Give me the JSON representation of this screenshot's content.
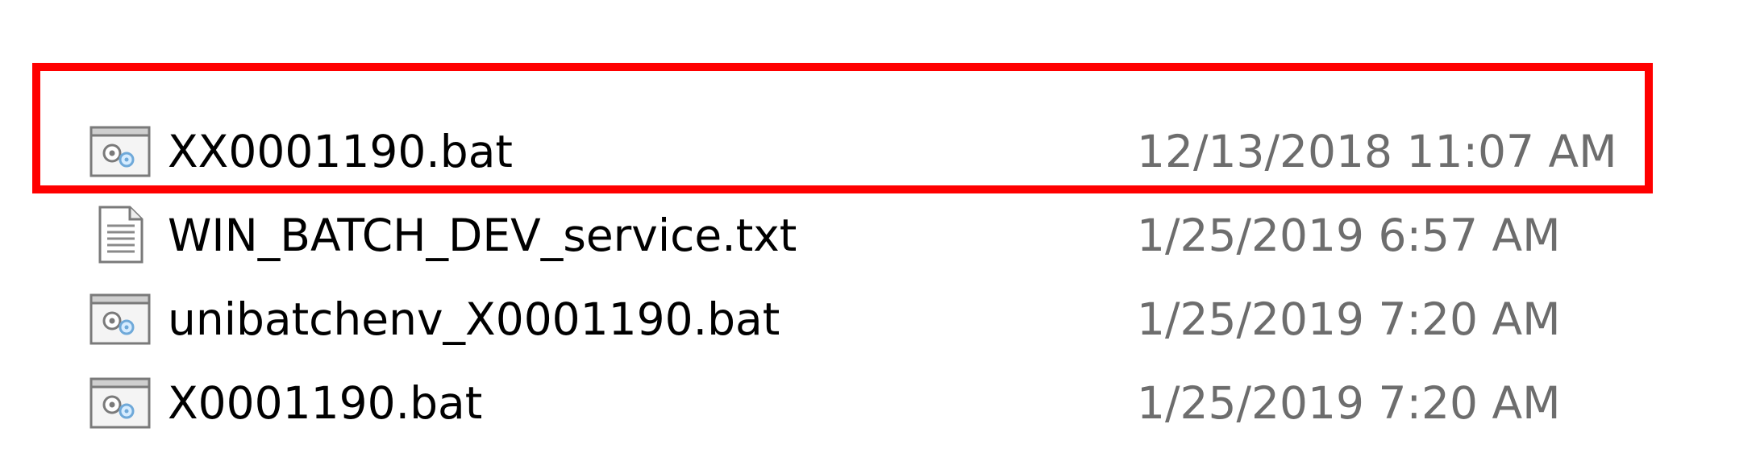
{
  "highlight": {
    "color": "#ff0000"
  },
  "files": [
    {
      "name": "XX0001190.bat",
      "date": "12/13/2018 11:07 AM",
      "icon": "batch-file-icon"
    },
    {
      "name": "WIN_BATCH_DEV_service.txt",
      "date": "1/25/2019 6:57 AM",
      "icon": "text-file-icon"
    },
    {
      "name": "unibatchenv_X0001190.bat",
      "date": "1/25/2019 7:20 AM",
      "icon": "batch-file-icon"
    },
    {
      "name": "X0001190.bat",
      "date": "1/25/2019 7:20 AM",
      "icon": "batch-file-icon"
    }
  ]
}
